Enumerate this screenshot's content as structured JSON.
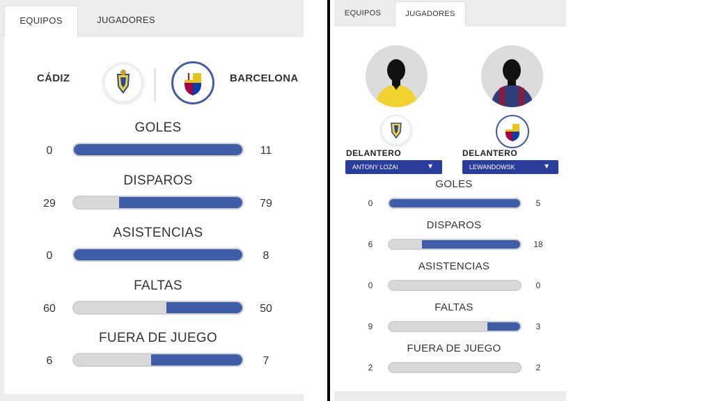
{
  "left": {
    "tabs": [
      {
        "label": "EQUIPOS"
      },
      {
        "label": "JUGADORES"
      }
    ],
    "home_team": "CÁDIZ",
    "away_team": "BARCELONA",
    "stats": [
      {
        "label": "GOLES",
        "home": "0",
        "away": "11",
        "away_fraction": 1.0
      },
      {
        "label": "DISPAROS",
        "home": "29",
        "away": "79",
        "away_fraction": 0.73
      },
      {
        "label": "ASISTENCIAS",
        "home": "0",
        "away": "8",
        "away_fraction": 1.0
      },
      {
        "label": "FALTAS",
        "home": "60",
        "away": "50",
        "away_fraction": 0.45
      },
      {
        "label": "FUERA DE JUEGO",
        "home": "6",
        "away": "7",
        "away_fraction": 0.54
      }
    ]
  },
  "right": {
    "tabs": [
      {
        "label": "EQUIPOS"
      },
      {
        "label": "JUGADORES"
      }
    ],
    "player1": {
      "position": "DELANTERO",
      "name": "ANTONY LOZAI"
    },
    "player2": {
      "position": "DELANTERO",
      "name": "LEWANDOWSK"
    },
    "stats": [
      {
        "label": "GOLES",
        "home": "0",
        "away": "5",
        "away_fraction": 1.0
      },
      {
        "label": "DISPAROS",
        "home": "6",
        "away": "18",
        "away_fraction": 0.75
      },
      {
        "label": "ASISTENCIAS",
        "home": "0",
        "away": "0",
        "away_fraction": 0.0
      },
      {
        "label": "FALTAS",
        "home": "9",
        "away": "3",
        "away_fraction": 0.25
      },
      {
        "label": "FUERA DE JUEGO",
        "home": "2",
        "away": "2",
        "away_fraction": 0.0
      }
    ]
  },
  "colors": {
    "accent": "#3f5da8",
    "select_bg": "#2a3d9a",
    "track": "#d9d9d9",
    "cadiz_yellow": "#f2d22e"
  }
}
